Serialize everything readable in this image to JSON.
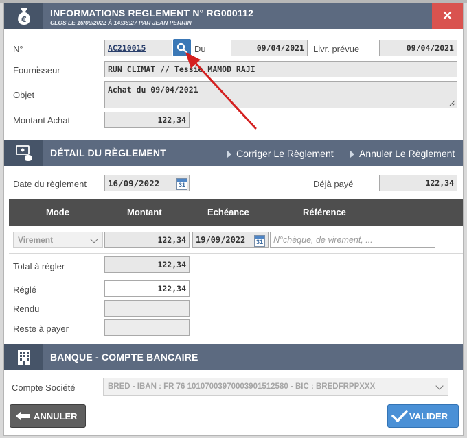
{
  "header": {
    "title": "INFORMATIONS REGLEMENT N° RG000112",
    "subtitle": "CLOS LE 16/09/2022 À 14:38:27 PAR JEAN PERRIN",
    "icon": "money-bag-icon",
    "close_label": "✕"
  },
  "info": {
    "no_label": "N°",
    "no_value": "AC210015",
    "du_label": "Du",
    "du_value": "09/04/2021",
    "livr_label": "Livr. prévue",
    "livr_value": "09/04/2021",
    "fournisseur_label": "Fournisseur",
    "fournisseur_value": "RUN CLIMAT // Tessie MAMOD RAJI",
    "objet_label": "Objet",
    "objet_value": "Achat du 09/04/2021",
    "montant_label": "Montant Achat",
    "montant_value": "122,34"
  },
  "detail": {
    "title": "DÉTAIL DU RÈGLEMENT",
    "corriger_label": "Corriger Le Règlement",
    "annuler_label": "Annuler Le Règlement",
    "date_label": "Date du règlement",
    "date_value": "16/09/2022",
    "deja_paye_label": "Déjà payé",
    "deja_paye_value": "122,34",
    "table_headers": [
      "Mode",
      "Montant",
      "Echéance",
      "Référence"
    ],
    "row": {
      "mode": "Virement",
      "montant": "122,34",
      "echeance": "19/09/2022",
      "reference_placeholder": "N°chèque, de virement, ..."
    },
    "calendar_day": "31",
    "total_label": "Total à régler",
    "total_value": "122,34",
    "regle_label": "Réglé",
    "regle_value": "122,34",
    "rendu_label": "Rendu",
    "rendu_value": "",
    "reste_label": "Reste à payer",
    "reste_value": ""
  },
  "banque": {
    "title": "BANQUE - COMPTE BANCAIRE",
    "compte_label": "Compte Société",
    "compte_value": "BRED - IBAN : FR 76 10107003970003901512580 - BIC : BREDFRPPXXX"
  },
  "footer": {
    "annuler_label": "ANNULER",
    "valider_label": "VALIDER"
  },
  "colors": {
    "header": "#5c6a80",
    "header_icon_bg": "#465468",
    "close": "#d9534f",
    "search_button": "#3b78b6",
    "annuler_button": "#5f5f5f",
    "valider_button": "#4a90d6",
    "arrow": "#d42020"
  }
}
